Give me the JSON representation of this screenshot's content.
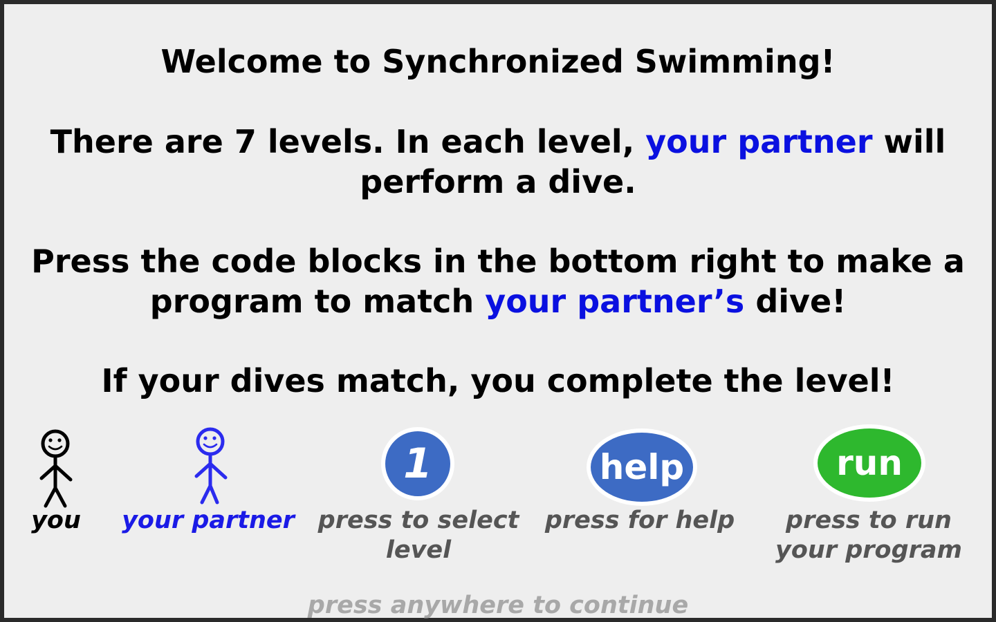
{
  "intro": {
    "title": "Welcome to Synchronized Swimming!",
    "p1_before": "There are 7 levels. In each level, ",
    "p1_highlight": "your partner",
    "p1_after": " will",
    "p1_line2": "perform a dive.",
    "p2_line1": "Press the code blocks in the bottom right to make a",
    "p2_before": "program to match ",
    "p2_highlight": "your partner’s",
    "p2_after": " dive!",
    "p3": "If your dives match, you complete the level!"
  },
  "legend": {
    "you": "you",
    "partner": "your partner",
    "level_button": "1",
    "level_caption_1": "press to select",
    "level_caption_2": "level",
    "help_button": "help",
    "help_caption": "press for help",
    "run_button": "run",
    "run_caption_1": "press to run",
    "run_caption_2": "your program"
  },
  "continue_prompt": "press anywhere to continue",
  "colors": {
    "highlight": "#0a10e0",
    "level_button": "#3d6bc4",
    "help_button": "#3d6bc4",
    "run_button": "#2eb82e"
  }
}
